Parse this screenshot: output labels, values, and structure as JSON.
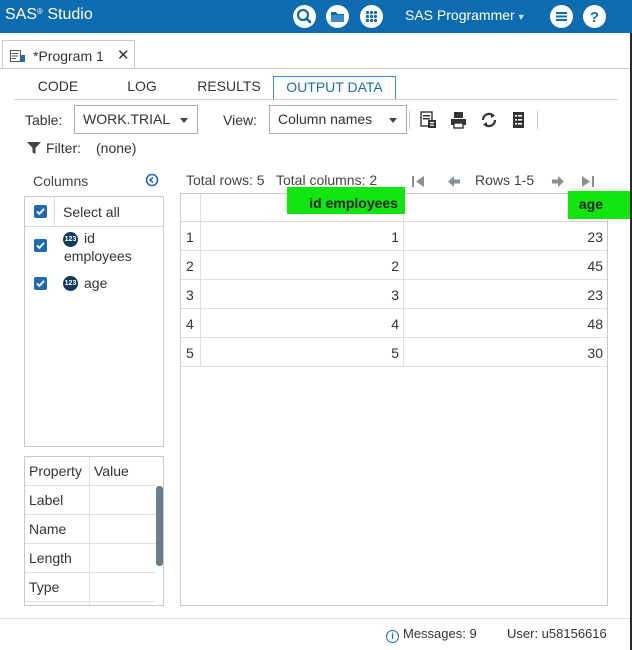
{
  "app": {
    "brand": "SAS",
    "brand_mark": "®",
    "brand_suffix": " Studio",
    "user_menu": "SAS Programmer"
  },
  "header_icons": [
    "search-icon",
    "folder-icon",
    "apps-grid-icon",
    "list-menu-icon",
    "help-icon"
  ],
  "program_tab": {
    "label": "*Program 1",
    "close": "✕"
  },
  "subtabs": [
    "CODE",
    "LOG",
    "RESULTS",
    "OUTPUT DATA"
  ],
  "active_subtab": "OUTPUT DATA",
  "toolbar": {
    "table_label": "Table:",
    "table_value": "WORK.TRIAL",
    "view_label": "View:",
    "view_value": "Column names",
    "filter_label": "Filter:",
    "filter_value": "(none)",
    "icons": [
      "export-data-icon",
      "print-icon",
      "refresh-icon",
      "table-properties-icon"
    ]
  },
  "columns_panel": {
    "title": "Columns",
    "select_all": "Select all",
    "columns": [
      {
        "name_line1": "id",
        "name_line2": "employees",
        "type_badge": "123",
        "checked": true
      },
      {
        "name_line1": "age",
        "name_line2": "",
        "type_badge": "123",
        "checked": true
      }
    ]
  },
  "properties_panel": {
    "headers": [
      "Property",
      "Value"
    ],
    "rows": [
      "Label",
      "Name",
      "Length",
      "Type"
    ]
  },
  "data_info": {
    "total_rows": "Total rows: 5",
    "total_columns": "Total columns: 2",
    "range": "Rows 1-5"
  },
  "grid": {
    "headers": [
      "id employees",
      "age"
    ],
    "rows": [
      {
        "n": "1",
        "id": "1",
        "age": "23"
      },
      {
        "n": "2",
        "id": "2",
        "age": "45"
      },
      {
        "n": "3",
        "id": "3",
        "age": "23"
      },
      {
        "n": "4",
        "id": "4",
        "age": "48"
      },
      {
        "n": "5",
        "id": "5",
        "age": "30"
      }
    ],
    "highlight_color": "#0ee60e"
  },
  "status": {
    "messages": "Messages: 9",
    "user": "User: u58156616",
    "info_glyph": "i"
  },
  "colors": {
    "header_bg": "#0d6bb0",
    "accent": "#1f6ab5",
    "badge": "#0f3a63"
  }
}
